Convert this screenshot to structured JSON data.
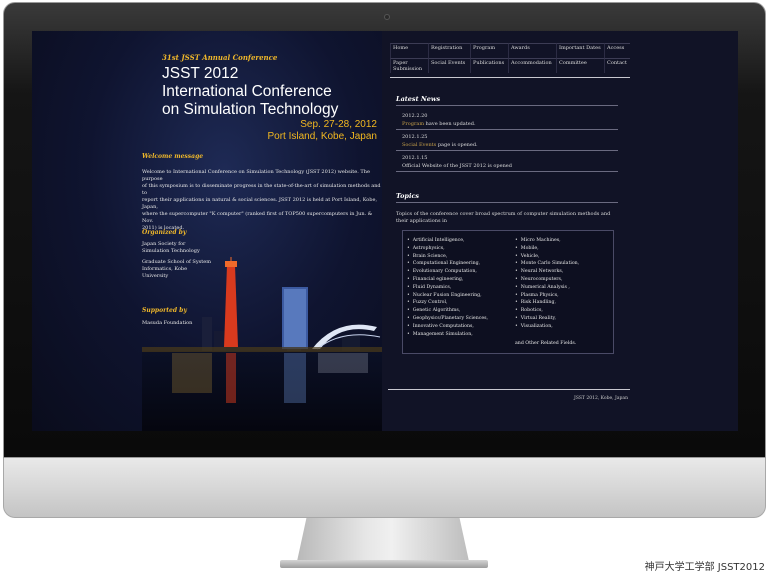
{
  "caption": "神戸大学工学部 JSST2012",
  "left": {
    "annual": "31st JSST Annual Conference",
    "title_lines": [
      "JSST 2012",
      "International Conference",
      "on Simulation Technology"
    ],
    "date": "Sep. 27-28, 2012",
    "place": "Port Island, Kobe, Japan",
    "welcome_head": "Welcome message",
    "welcome_lines": [
      "Welcome to International Conference on Simulation Technology (JSST 2012) website. The purpose",
      "of this symposium is to disseminate progress in the state-of-the-art of simulation methods and to",
      "report their applications in natural & social sciences. JSST 2012 is held at Port Island, Kobe, Japan,",
      "where the supercomputer \"K computer\" (ranked first of TOP500 supercomputers in Jun. & Nov.",
      "2011) is located."
    ],
    "organized_head": "Organized by",
    "organized_lines": [
      "Japan Society for",
      "Simulation Technology",
      "",
      "Graduate School of System",
      "Informatics, Kobe",
      "University"
    ],
    "supported_head": "Supported by",
    "supported_lines": [
      "Masuda Foundation"
    ]
  },
  "nav": [
    {
      "label": "Home"
    },
    {
      "label": "Registration"
    },
    {
      "label": "Program"
    },
    {
      "label": "Awards"
    },
    {
      "label": "Important Dates"
    },
    {
      "label": "Access"
    },
    {
      "label": "Paper Submission"
    },
    {
      "label": "Social Events"
    },
    {
      "label": "Publications"
    },
    {
      "label": "Accommodation"
    },
    {
      "label": "Committee"
    },
    {
      "label": "Contact"
    }
  ],
  "news": {
    "head": "Latest News",
    "items": [
      {
        "date": "2012.2.20",
        "link": "Program",
        "text": " have been updated."
      },
      {
        "date": "2012.1.25",
        "link": "Social Events",
        "text": " page is opened."
      },
      {
        "date": "2012.1.15",
        "link": "",
        "text": "Official Website of the JSST 2012 is opened"
      }
    ]
  },
  "topics": {
    "head": "Topics",
    "intro": "Topics of the conference cover broad spectrum of computer simulation methods and their applications in",
    "col1": [
      "Artificial Intelligence,",
      "Astrophysics,",
      "Brain Science,",
      "Computational Engineering,",
      "Evolutionary Computation,",
      "Financial egineering,",
      "Fluid Dynamics,",
      "Nuclear Fusion Engineering,",
      "Fuzzy Control,",
      "Genetic Algorithms,",
      "Geophysics/Planetary Sciences,",
      "Innovative Computations,",
      "Management Simulation,"
    ],
    "col2": [
      "Micro Machines,",
      "Mobile,",
      "Vehicle,",
      "Monte Carlo Simulation,",
      "Neural Networks,",
      "Neurocomputers,",
      "Numerical Analysis ,",
      "Plasma Physics,",
      "Risk Handling,",
      "Robotics,",
      "Virtual Reality,",
      "Visualization,"
    ],
    "other": "and Other Related Fields."
  },
  "footer": "JSST 2012, Kobe, Japan"
}
